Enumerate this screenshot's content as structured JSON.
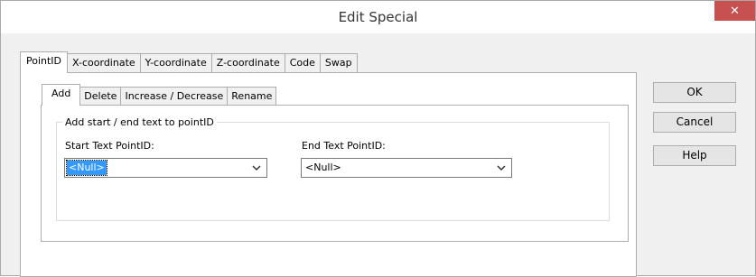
{
  "window": {
    "title": "Edit Special",
    "close_symbol": "✕"
  },
  "tabs_outer": [
    "PointID",
    "X-coordinate",
    "Y-coordinate",
    "Z-coordinate",
    "Code",
    "Swap"
  ],
  "tabs_inner": [
    "Add",
    "Delete",
    "Increase / Decrease",
    "Rename"
  ],
  "group": {
    "legend": "Add start / end text to pointID",
    "start_label": "Start Text PointID:",
    "start_value": "<Null>",
    "end_label": "End Text PointID:",
    "end_value": "<Null>"
  },
  "buttons": {
    "ok": "OK",
    "cancel": "Cancel",
    "help": "Help"
  },
  "colors": {
    "close_red": "#c75050",
    "selection_blue": "#3399ff"
  }
}
